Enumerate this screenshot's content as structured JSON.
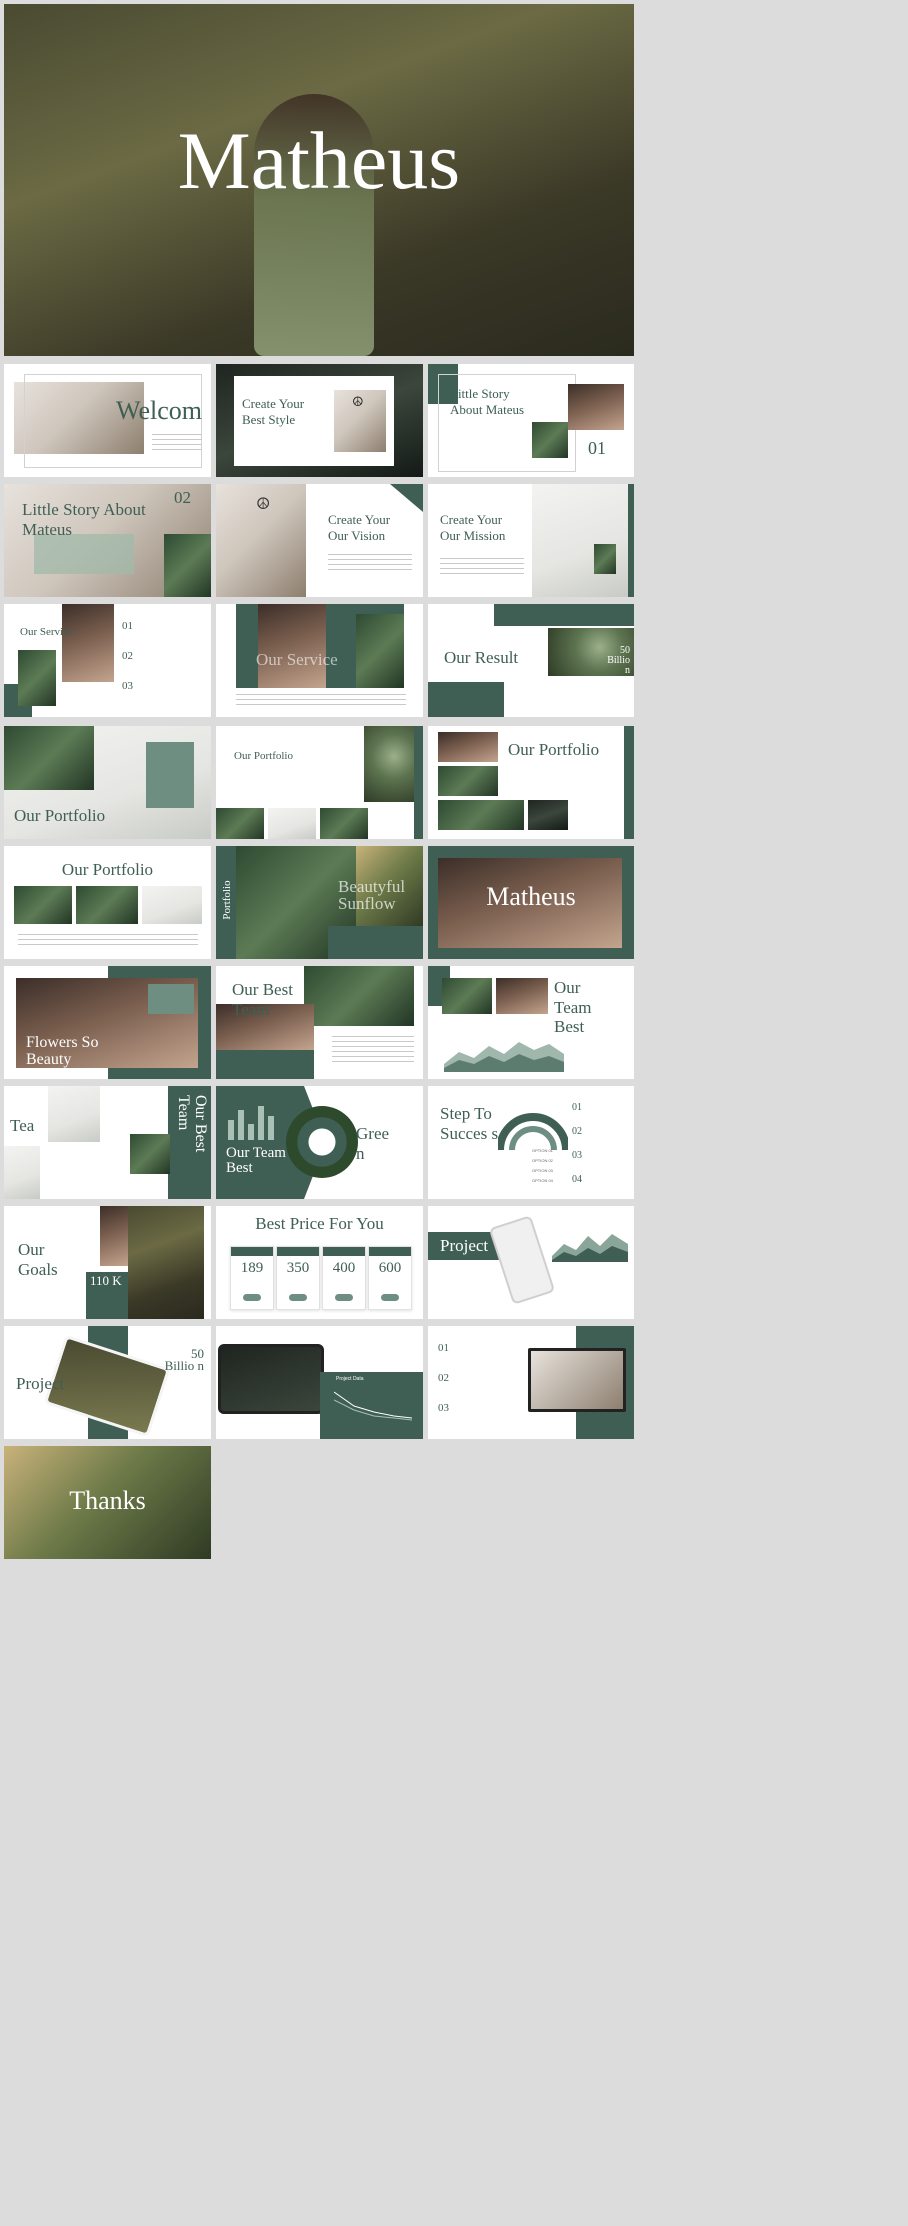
{
  "hero": {
    "title": "Matheus"
  },
  "slides": {
    "welcome": {
      "title": "Welcom"
    },
    "best_style": {
      "title": "Create Your Best Style"
    },
    "little_story_1": {
      "title": "Little Story About Mateus",
      "number": "01"
    },
    "little_story_2": {
      "title": "Little Story About Mateus",
      "number": "02"
    },
    "vision": {
      "title": "Create Your Our Vision"
    },
    "mission": {
      "title": "Create Your Our Mission"
    },
    "service_1": {
      "title": "Our Service",
      "numbers": [
        "01",
        "02",
        "03"
      ]
    },
    "service_2": {
      "title": "Our Service"
    },
    "result": {
      "title": "Our Result",
      "stat": "50 Billio n"
    },
    "portfolio_1": {
      "title": "Our Portfolio"
    },
    "portfolio_2": {
      "title": "Our Portfolio"
    },
    "portfolio_3": {
      "title": "Our Portfolio"
    },
    "portfolio_4": {
      "title": "Our Portfolio"
    },
    "beautiful": {
      "side": "Portfolio",
      "title": "Beautyful Sunflow"
    },
    "matheus": {
      "title": "Matheus"
    },
    "flowers": {
      "title": "Flowers So Beauty"
    },
    "best_team": {
      "title": "Our Best Team"
    },
    "our_team_best": {
      "title": "Our Team Best"
    },
    "team_vertical": {
      "left": "Tea",
      "vertical": "Our Best Team"
    },
    "our_team_chart": {
      "title": "Our Team Best",
      "side": "Gree n"
    },
    "step": {
      "title": "Step To Succes s",
      "numbers": [
        "01",
        "02",
        "03",
        "04"
      ],
      "options": [
        "OPTION 01",
        "OPTION 02",
        "OPTION 03",
        "OPTION 04"
      ]
    },
    "goals": {
      "title": "Our Goals",
      "stat": "110 K"
    },
    "price": {
      "title": "Best Price For You",
      "prices": [
        "189",
        "350",
        "400",
        "600"
      ]
    },
    "project_phone": {
      "title": "Project"
    },
    "project_tablet": {
      "title": "Project",
      "stat": "50 Billio n"
    },
    "laptop": {
      "chart_title": "Project Data"
    },
    "desktop": {
      "numbers": [
        "01",
        "02",
        "03"
      ]
    },
    "thanks": {
      "title": "Thanks"
    }
  }
}
